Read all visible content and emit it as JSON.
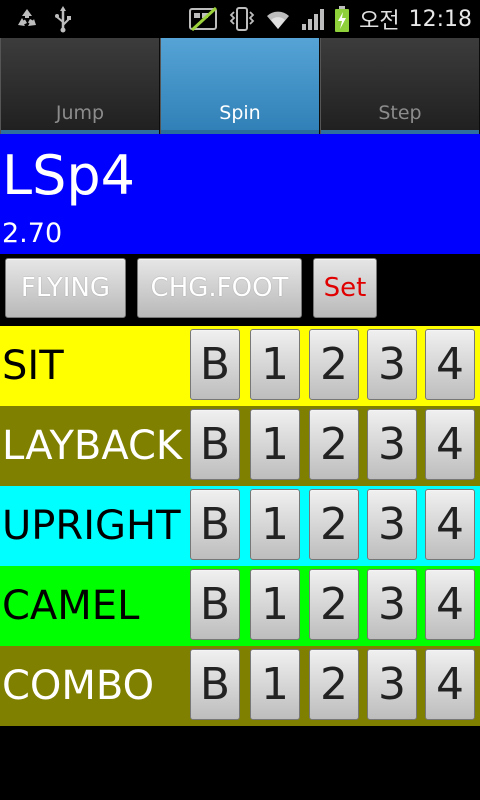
{
  "status_bar": {
    "left_icons": [
      "recycle-icon",
      "usb-icon"
    ],
    "right_icons": [
      "no-sim-icon",
      "vibrate-icon",
      "wifi-icon",
      "signal-icon",
      "battery-charging-icon"
    ],
    "carrier": "오전",
    "time": "12:18"
  },
  "tabs": [
    {
      "label": "Jump",
      "active": false
    },
    {
      "label": "Spin",
      "active": true
    },
    {
      "label": "Step",
      "active": false
    }
  ],
  "element": {
    "code": "LSp4",
    "value": "2.70"
  },
  "modifiers": {
    "flying": "FLYING",
    "change_foot": "CHG.FOOT",
    "set": "Set"
  },
  "spin_rows": [
    {
      "label": "SIT",
      "bg": "#ffff00",
      "fg": "#000000"
    },
    {
      "label": "LAYBACK",
      "bg": "#808000",
      "fg": "#ffffff"
    },
    {
      "label": "UPRIGHT",
      "bg": "#00ffff",
      "fg": "#000000"
    },
    {
      "label": "CAMEL",
      "bg": "#00ff00",
      "fg": "#000000"
    },
    {
      "label": "COMBO",
      "bg": "#808000",
      "fg": "#ffffff"
    }
  ],
  "levels": [
    "B",
    "1",
    "2",
    "3",
    "4"
  ],
  "colors": {
    "header_bg": "#0000ff",
    "active_tab": "#3f92c8",
    "set_text": "#e00000"
  }
}
